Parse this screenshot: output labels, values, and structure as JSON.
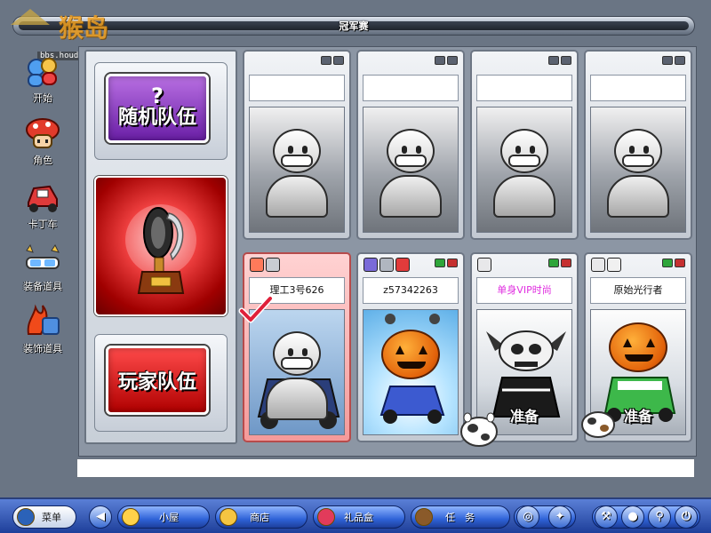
{
  "window": {
    "title": "冠军赛"
  },
  "watermark": {
    "logo_text": "猴岛",
    "url": "bbs.houdao.com"
  },
  "sidebar": {
    "items": [
      {
        "label": "开始",
        "icon": "start-icon"
      },
      {
        "label": "角色",
        "icon": "character-icon"
      },
      {
        "label": "卡丁车",
        "icon": "kart-icon"
      },
      {
        "label": "装备道具",
        "icon": "equipment-icon"
      },
      {
        "label": "装饰道具",
        "icon": "decoration-icon"
      }
    ]
  },
  "team_buttons": {
    "random": {
      "symbol": "?",
      "label": "随机队伍"
    },
    "player": {
      "label": "玩家队伍"
    }
  },
  "slots_top": [
    {
      "name": ""
    },
    {
      "name": ""
    },
    {
      "name": ""
    },
    {
      "name": ""
    }
  ],
  "slots_bottom": [
    {
      "name": "理工3号626",
      "ready": ""
    },
    {
      "name": "z57342263",
      "ready": ""
    },
    {
      "name": "单身VIP时尚",
      "ready": "准备"
    },
    {
      "name": "原始光行者",
      "ready": "准备"
    }
  ],
  "taskbar": {
    "menu": "菜单",
    "cottage": "小屋",
    "shop": "商店",
    "giftbox": "礼品盒",
    "task": "任　务"
  },
  "colors": {
    "accent_purple": "#6a1fa6",
    "accent_red": "#b00000",
    "taskbar_blue": "#2f63d8"
  }
}
